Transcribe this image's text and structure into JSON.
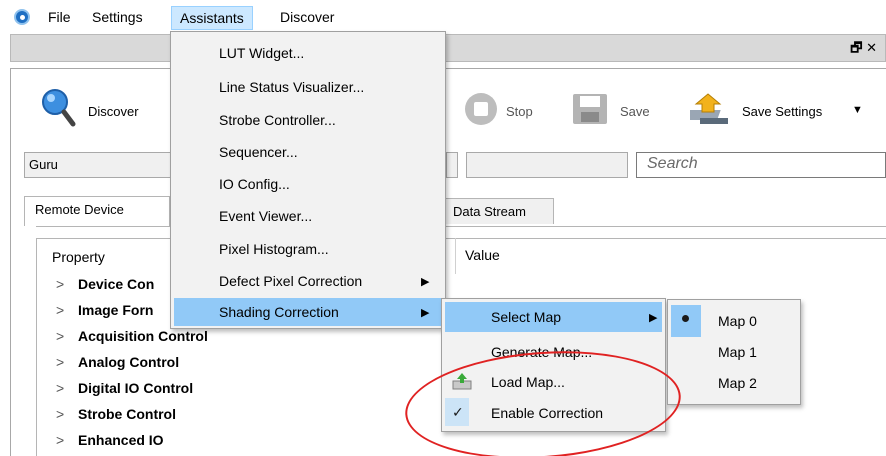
{
  "menubar": {
    "file": "File",
    "settings": "Settings",
    "assistants": "Assistants",
    "discover": "Discover"
  },
  "panel_controls": "🗗 ✕",
  "toolbar": {
    "discover": "Discover",
    "stop": "Stop",
    "save": "Save",
    "save_settings": "Save Settings"
  },
  "visibility": "Guru",
  "search_placeholder": "Search",
  "tabs": {
    "remote_device": "Remote Device",
    "data_stream": "Data Stream"
  },
  "grid": {
    "property_header": "Property",
    "value_header": "Value",
    "rows": [
      "Device Con",
      "Image Forn",
      "Acquisition Control",
      "Analog Control",
      "Digital IO Control",
      "Strobe Control",
      "Enhanced IO"
    ]
  },
  "assistants_menu": [
    "LUT Widget...",
    "Line Status Visualizer...",
    "Strobe Controller...",
    "Sequencer...",
    "IO Config...",
    "Event Viewer...",
    "Pixel Histogram...",
    "Defect Pixel Correction",
    "Shading Correction"
  ],
  "shading_menu": [
    "Select Map",
    "Generate Map...",
    "Load Map...",
    "Enable Correction"
  ],
  "map_menu": [
    "Map 0",
    "Map 1",
    "Map 2"
  ],
  "selected_map": "Map 0",
  "enable_correction_checked": true,
  "colors": {
    "menu_highlight": "#91c9f7",
    "active_menu": "#cce8ff",
    "annotation": "#e02222"
  }
}
